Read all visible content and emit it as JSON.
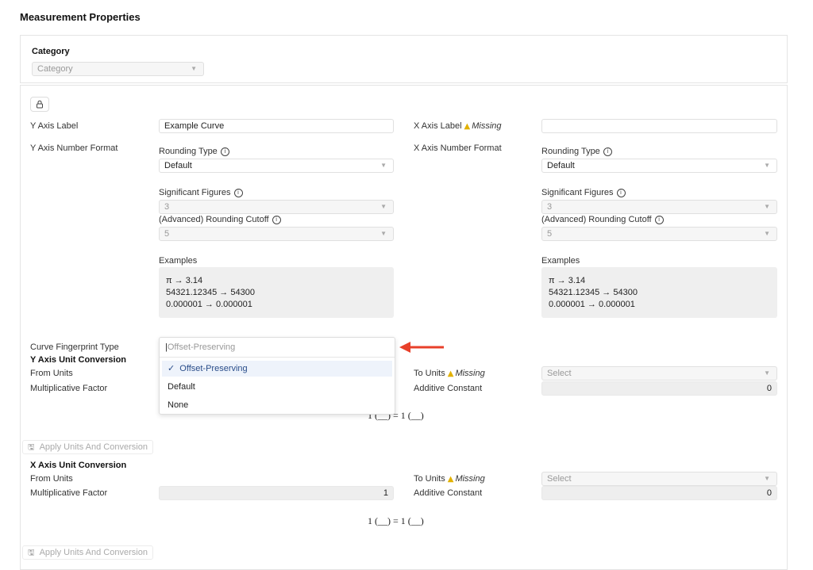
{
  "page": {
    "title": "Measurement Properties"
  },
  "category": {
    "label": "Category",
    "placeholder": "Category"
  },
  "y_axis": {
    "label_title": "Y Axis Label",
    "label_value": "Example Curve",
    "number_format_title": "Y Axis Number Format",
    "rounding_type_label": "Rounding Type",
    "rounding_type_value": "Default",
    "sig_figs_label": "Significant Figures",
    "sig_figs_value": "3",
    "cutoff_label": "(Advanced) Rounding Cutoff",
    "cutoff_value": "5",
    "examples_label": "Examples",
    "examples": [
      "π → 3.14",
      "54321.12345 → 54300",
      "0.000001 → 0.000001"
    ]
  },
  "x_axis": {
    "label_title": "X Axis Label",
    "missing": "Missing",
    "label_value": "",
    "number_format_title": "X Axis Number Format",
    "rounding_type_label": "Rounding Type",
    "rounding_type_value": "Default",
    "sig_figs_label": "Significant Figures",
    "sig_figs_value": "3",
    "cutoff_label": "(Advanced) Rounding Cutoff",
    "cutoff_value": "5",
    "examples_label": "Examples",
    "examples": [
      "π → 3.14",
      "54321.12345 → 54300",
      "0.000001 → 0.000001"
    ]
  },
  "fingerprint": {
    "label": "Curve Fingerprint Type",
    "placeholder": "Offset-Preserving",
    "options": [
      "Offset-Preserving",
      "Default",
      "None"
    ],
    "selected_mark": "✓"
  },
  "y_conversion": {
    "title": "Y Axis Unit Conversion",
    "from_units": "From Units",
    "to_units": "To Units",
    "missing": "Missing",
    "to_units_value": "Select",
    "mult_factor_label": "Multiplicative Factor",
    "additive_label": "Additive Constant",
    "additive_value": "0",
    "formula": "1 (__) = 1 (__)",
    "apply_label": "Apply Units And Conversion"
  },
  "x_conversion": {
    "title": "X Axis Unit Conversion",
    "from_units": "From Units",
    "to_units": "To Units",
    "missing": "Missing",
    "to_units_value": "Select",
    "mult_factor_label": "Multiplicative Factor",
    "mult_factor_value": "1",
    "additive_label": "Additive Constant",
    "additive_value": "0",
    "formula": "1 (__) = 1 (__)",
    "apply_label": "Apply Units And Conversion"
  },
  "icons": {
    "lock": "lock-icon",
    "info": "info-icon",
    "warning": "warning-icon",
    "caret": "chevron-down-icon",
    "save": "save-icon",
    "arrow": "red-arrow-annotation"
  },
  "colors": {
    "warning": "#e2b100",
    "arrow": "#e8402a",
    "selected_option": "#2a4d8a"
  }
}
